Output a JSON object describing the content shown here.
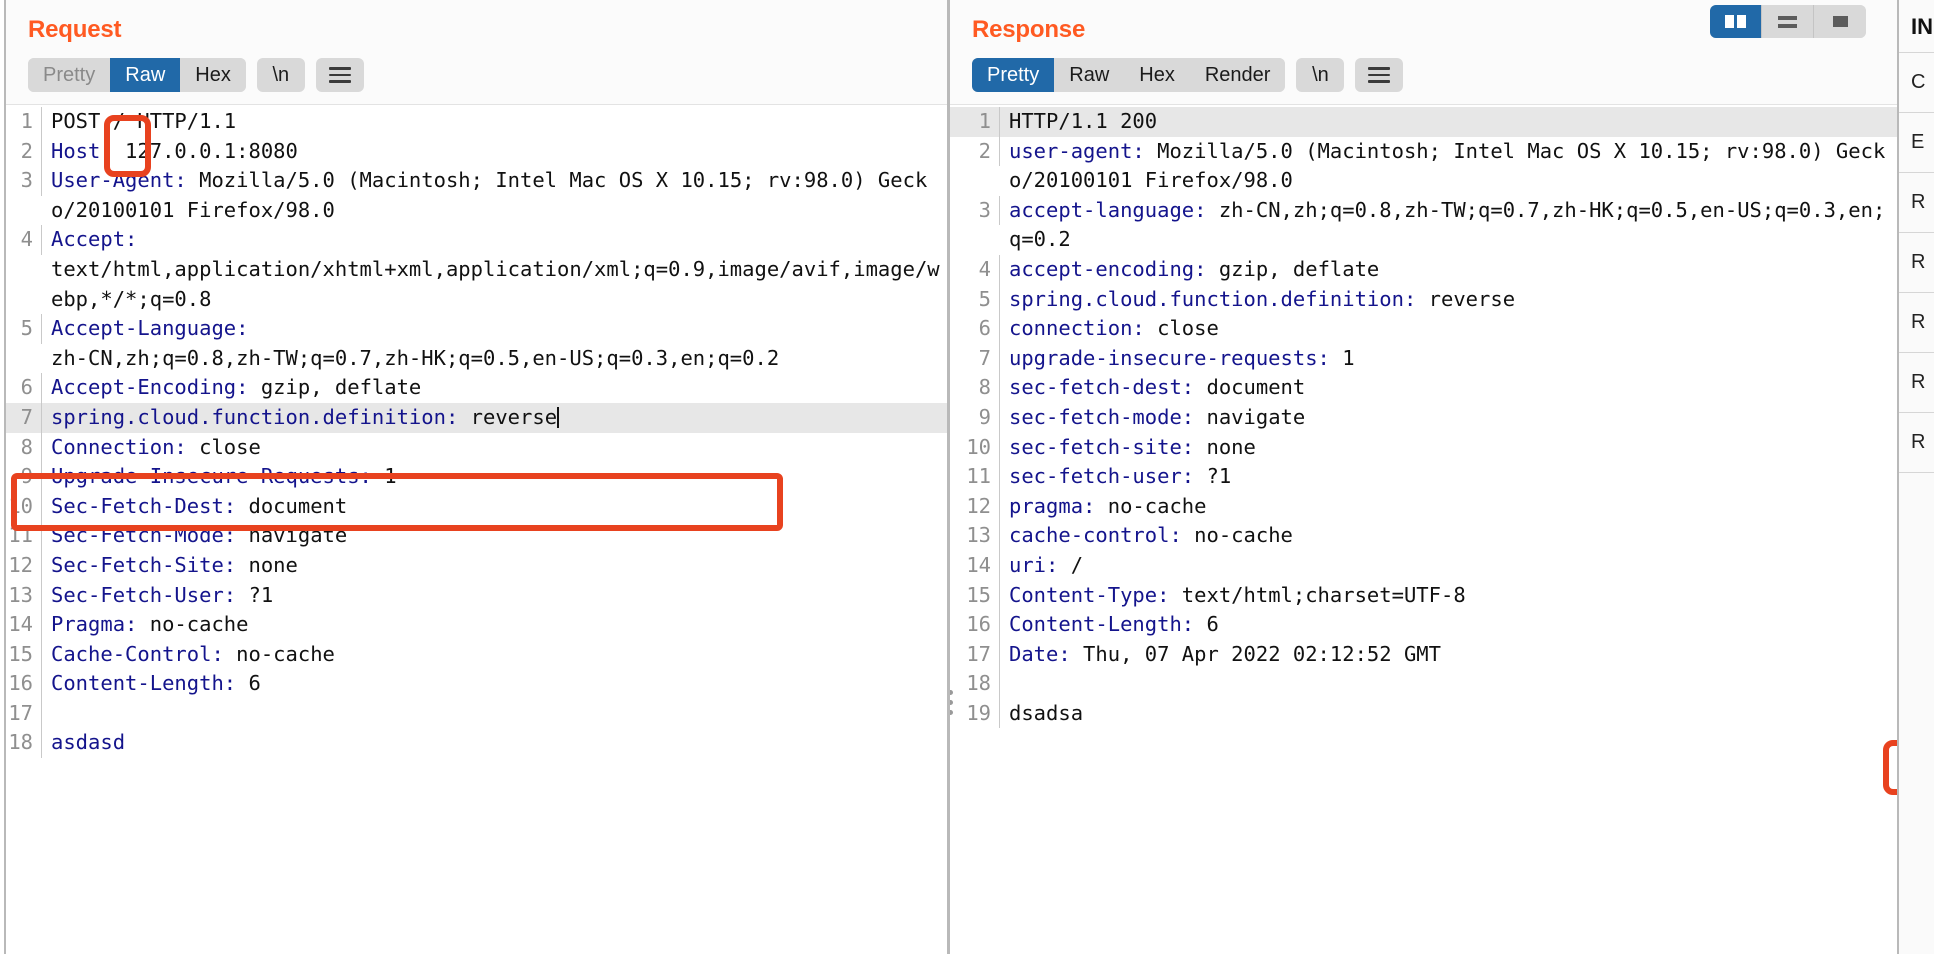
{
  "view_mode": {
    "options": [
      "split-view-icon",
      "stacked-view-icon",
      "single-view-icon"
    ],
    "active": "split-view-icon"
  },
  "request": {
    "title": "Request",
    "tabs": [
      {
        "label": "Pretty",
        "active": false
      },
      {
        "label": "Raw",
        "active": true
      },
      {
        "label": "Hex",
        "active": false
      }
    ],
    "newline_button": "\\n",
    "menu_icon": "hamburger-icon",
    "lines": [
      {
        "num": "1",
        "header": "",
        "value": "POST / HTTP/1.1",
        "plain": true
      },
      {
        "num": "2",
        "header": "Host",
        "value": " 127.0.0.1:8080"
      },
      {
        "num": "3",
        "header": "User-Agent",
        "value": " Mozilla/5.0 (Macintosh; Intel Mac OS X 10.15; rv:98.0) Gecko/20100101 Firefox/98.0"
      },
      {
        "num": "4",
        "header": "Accept",
        "value": " \ntext/html,application/xhtml+xml,application/xml;q=0.9,image/avif,image/webp,*/*;q=0.8"
      },
      {
        "num": "5",
        "header": "Accept-Language",
        "value": " \nzh-CN,zh;q=0.8,zh-TW;q=0.7,zh-HK;q=0.5,en-US;q=0.3,en;q=0.2"
      },
      {
        "num": "6",
        "header": "Accept-Encoding",
        "value": " gzip, deflate"
      },
      {
        "num": "7",
        "header": "spring.cloud.function.definition",
        "value": " reverse",
        "highlighted": true,
        "caret": true
      },
      {
        "num": "8",
        "header": "Connection",
        "value": " close"
      },
      {
        "num": "9",
        "header": "Upgrade-Insecure-Requests",
        "value": " 1"
      },
      {
        "num": "10",
        "header": "Sec-Fetch-Dest",
        "value": " document"
      },
      {
        "num": "11",
        "header": "Sec-Fetch-Mode",
        "value": " navigate"
      },
      {
        "num": "12",
        "header": "Sec-Fetch-Site",
        "value": " none"
      },
      {
        "num": "13",
        "header": "Sec-Fetch-User",
        "value": " ?1"
      },
      {
        "num": "14",
        "header": "Pragma",
        "value": " no-cache"
      },
      {
        "num": "15",
        "header": "Cache-Control",
        "value": " no-cache"
      },
      {
        "num": "16",
        "header": "Content-Length",
        "value": " 6"
      },
      {
        "num": "17",
        "header": "",
        "value": ""
      },
      {
        "num": "18",
        "header": "asdasd",
        "value": "",
        "body": true
      }
    ]
  },
  "response": {
    "title": "Response",
    "tabs": [
      {
        "label": "Pretty",
        "active": true
      },
      {
        "label": "Raw",
        "active": false
      },
      {
        "label": "Hex",
        "active": false
      },
      {
        "label": "Render",
        "active": false
      }
    ],
    "newline_button": "\\n",
    "menu_icon": "hamburger-icon",
    "lines": [
      {
        "num": "1",
        "header": "",
        "value": "HTTP/1.1 200",
        "plain": true,
        "highlighted": true
      },
      {
        "num": "2",
        "header": "user-agent",
        "value": " Mozilla/5.0 (Macintosh; Intel Mac OS X 10.15; rv:98.0) Gecko/20100101 Firefox/98.0"
      },
      {
        "num": "3",
        "header": "accept-language",
        "value": " zh-CN,zh;q=0.8,zh-TW;q=0.7,zh-HK;q=0.5,en-US;q=0.3,en;q=0.2"
      },
      {
        "num": "4",
        "header": "accept-encoding",
        "value": " gzip, deflate"
      },
      {
        "num": "5",
        "header": "spring.cloud.function.definition",
        "value": " reverse"
      },
      {
        "num": "6",
        "header": "connection",
        "value": " close"
      },
      {
        "num": "7",
        "header": "upgrade-insecure-requests",
        "value": " 1"
      },
      {
        "num": "8",
        "header": "sec-fetch-dest",
        "value": " document"
      },
      {
        "num": "9",
        "header": "sec-fetch-mode",
        "value": " navigate"
      },
      {
        "num": "10",
        "header": "sec-fetch-site",
        "value": " none"
      },
      {
        "num": "11",
        "header": "sec-fetch-user",
        "value": " ?1"
      },
      {
        "num": "12",
        "header": "pragma",
        "value": " no-cache"
      },
      {
        "num": "13",
        "header": "cache-control",
        "value": " no-cache"
      },
      {
        "num": "14",
        "header": "uri",
        "value": " /"
      },
      {
        "num": "15",
        "header": "Content-Type",
        "value": " text/html;charset=UTF-8"
      },
      {
        "num": "16",
        "header": "Content-Length",
        "value": " 6"
      },
      {
        "num": "17",
        "header": "Date",
        "value": " Thu, 07 Apr 2022 02:12:52 GMT"
      },
      {
        "num": "18",
        "header": "",
        "value": ""
      },
      {
        "num": "19",
        "header": "",
        "value": "dsadsa",
        "plain": true,
        "body": true
      }
    ]
  },
  "inspector": {
    "title": "IN",
    "rows": [
      "C",
      "E",
      "R",
      "R",
      "R",
      "R",
      "R"
    ]
  },
  "annotations": {
    "slash": "red-box-request-path",
    "spring_header_line": "red-box-spring-cloud-function-definition",
    "response_body": "red-box-response-body"
  },
  "colors": {
    "accent_orange": "#ff5a22",
    "active_blue": "#2169a8",
    "header_blue": "#14148c",
    "annotation_red": "#e8421f"
  }
}
